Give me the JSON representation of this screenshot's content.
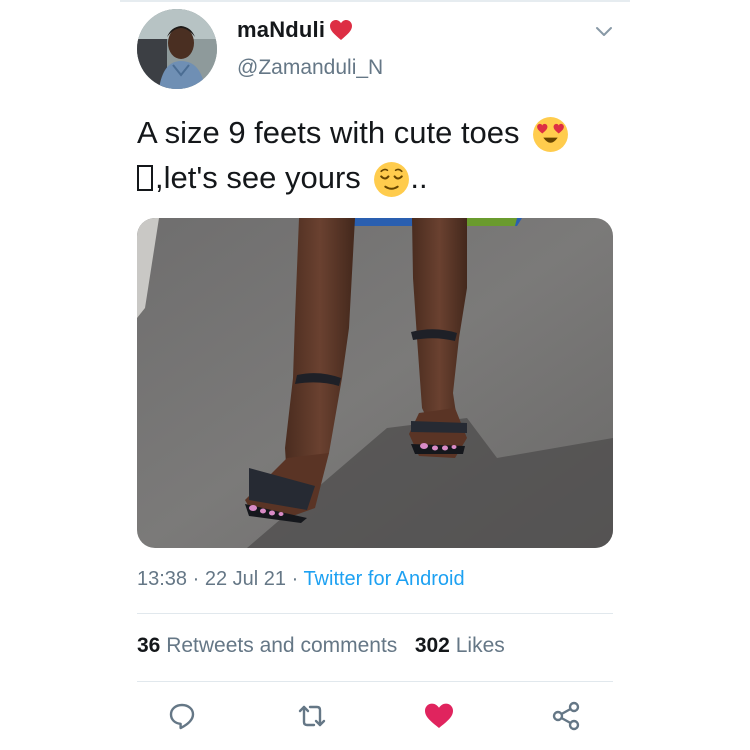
{
  "user": {
    "display_name": "maNduli",
    "handle": "@Zamanduli_N",
    "name_icon": "red-heart-icon"
  },
  "tweet": {
    "line1": "A size 9 feets with cute toes",
    "line2_missing_glyph": "⍰",
    "line2": ",let's see yours",
    "line2_end": "..",
    "emoji1": "heart-eyes-emoji",
    "emoji2": "relieved-face-emoji"
  },
  "meta": {
    "time": "13:38",
    "sep1": " · ",
    "date": "22 Jul 21",
    "sep2": " · ",
    "source": "Twitter for Android"
  },
  "stats": {
    "retweets_count": "36",
    "retweets_label": "Retweets and comments",
    "likes_count": "302",
    "likes_label": "Likes"
  },
  "actions": [
    "reply-icon",
    "retweet-icon",
    "like-icon",
    "share-icon"
  ],
  "colors": {
    "accent": "#1da1f2",
    "like": "#e0245e",
    "text": "#14171a",
    "muted": "#657786"
  }
}
